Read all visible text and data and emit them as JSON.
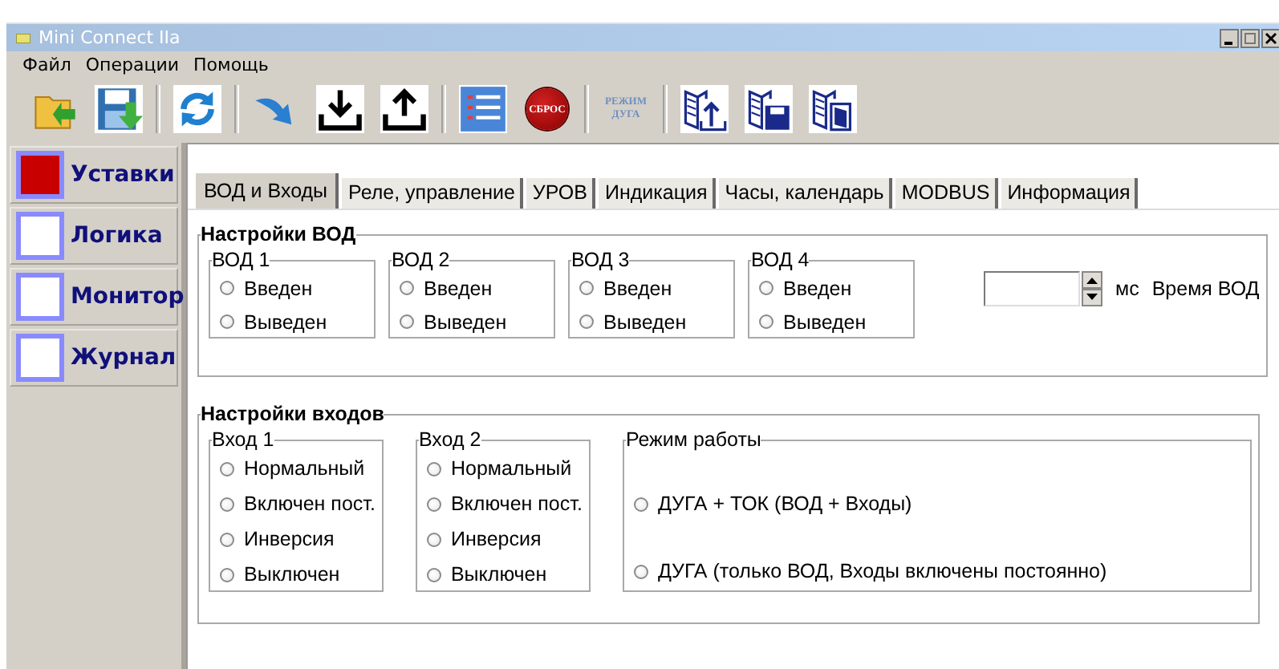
{
  "window": {
    "title": "Mini Connect IIa"
  },
  "menu": [
    "Файл",
    "Операции",
    "Помощь"
  ],
  "toolbar": {
    "reset_label": "СБРОС",
    "arc_mode_label": [
      "РЕЖИМ",
      "ДУГА"
    ]
  },
  "sidebar": {
    "items": [
      {
        "label": "Уставки",
        "selected": true
      },
      {
        "label": "Логика",
        "selected": false
      },
      {
        "label": "Монитор",
        "selected": false
      },
      {
        "label": "Журнал",
        "selected": false
      }
    ]
  },
  "tabs": [
    {
      "label": "ВОД и Входы",
      "selected": true
    },
    {
      "label": "Реле, управление",
      "selected": false
    },
    {
      "label": "УРОВ",
      "selected": false
    },
    {
      "label": "Индикация",
      "selected": false
    },
    {
      "label": "Часы, календарь",
      "selected": false
    },
    {
      "label": "MODBUS",
      "selected": false
    },
    {
      "label": "Информация",
      "selected": false
    }
  ],
  "vod_settings": {
    "title": "Настройки ВОД",
    "groups": [
      {
        "title": "ВОД 1",
        "options": [
          {
            "label": "Введен",
            "selected": false
          },
          {
            "label": "Выведен",
            "selected": false
          }
        ]
      },
      {
        "title": "ВОД 2",
        "options": [
          {
            "label": "Введен",
            "selected": false
          },
          {
            "label": "Выведен",
            "selected": false
          }
        ]
      },
      {
        "title": "ВОД 3",
        "options": [
          {
            "label": "Введен",
            "selected": false
          },
          {
            "label": "Выведен",
            "selected": false
          }
        ]
      },
      {
        "title": "ВОД 4",
        "options": [
          {
            "label": "Введен",
            "selected": false
          },
          {
            "label": "Выведен",
            "selected": false
          }
        ]
      }
    ],
    "time": {
      "unit": "мс",
      "label": "Время ВОД"
    }
  },
  "input_settings": {
    "title": "Настройки входов",
    "groups": [
      {
        "title": "Вход 1",
        "options": [
          {
            "label": "Нормальный",
            "selected": false
          },
          {
            "label": "Включен пост.",
            "selected": false
          },
          {
            "label": "Инверсия",
            "selected": false
          },
          {
            "label": "Выключен",
            "selected": false
          }
        ]
      },
      {
        "title": "Вход 2",
        "options": [
          {
            "label": "Нормальный",
            "selected": false
          },
          {
            "label": "Включен пост.",
            "selected": false
          },
          {
            "label": "Инверсия",
            "selected": false
          },
          {
            "label": "Выключен",
            "selected": false
          }
        ]
      }
    ],
    "mode": {
      "title": "Режим работы",
      "options": [
        {
          "label": "ДУГА + ТОК  (ВОД + Входы)",
          "selected": false
        },
        {
          "label": "ДУГА  (только ВОД, Входы включены постоянно)",
          "selected": false
        }
      ]
    }
  }
}
